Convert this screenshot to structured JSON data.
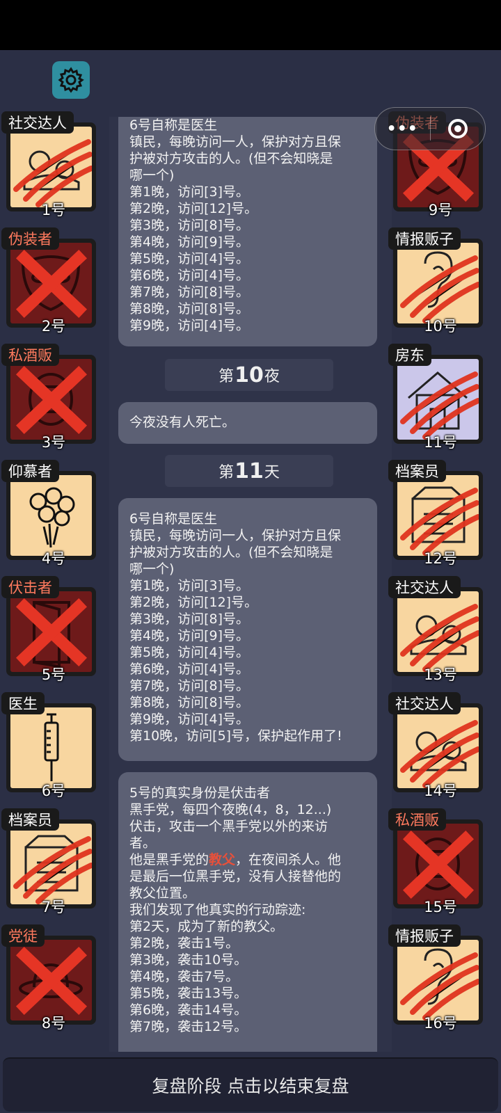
{
  "log": {
    "card1_lines": [
      "6号自称是医生",
      "镇民，每晚访问一人，保护对方且保",
      "护被对方攻击的人。(但不会知晓是",
      "哪一个)",
      "第1晚，访问[3]号。",
      "第2晚，访问[12]号。",
      "第3晚，访问[8]号。",
      "第4晚，访问[9]号。",
      "第5晚，访问[4]号。",
      "第6晚，访问[4]号。",
      "第7晚，访问[8]号。",
      "第8晚，访问[8]号。",
      "第9晚，访问[4]号。"
    ],
    "night10": {
      "pre": "第",
      "num": "10",
      "post": "夜"
    },
    "card2_text": "今夜没有人死亡。",
    "day11": {
      "pre": "第",
      "num": "11",
      "post": "天"
    },
    "card3_lines": [
      "6号自称是医生",
      "镇民，每晚访问一人，保护对方且保",
      "护被对方攻击的人。(但不会知晓是",
      "哪一个)",
      "第1晚，访问[3]号。",
      "第2晚，访问[12]号。",
      "第3晚，访问[8]号。",
      "第4晚，访问[9]号。",
      "第5晚，访问[4]号。",
      "第6晚，访问[4]号。",
      "第7晚，访问[8]号。",
      "第8晚，访问[8]号。",
      "第9晚，访问[4]号。",
      "第10晚，访问[5]号，保护起作用了!"
    ],
    "card4": {
      "l1": "5号的真实身份是伏击者",
      "l2": "黑手党，每四个夜晚(4，8，12...)",
      "l3": "伏击，攻击一个黑手党以外的来访",
      "l4": "者。",
      "l5_pre": "他是黑手党的",
      "l5_red": "教父",
      "l5_post": "，在夜间杀人。他",
      "l6": "是最后一位黑手党，没有人接替他的",
      "l7": "教父位置。",
      "l8": "我们发现了他真实的行动踪迹:",
      "l9": "第2天，成为了新的教父。",
      "l10": "第2晚，袭击1号。",
      "l11": "第3晚，袭击10号。",
      "l12": "第4晚，袭击7号。",
      "l13": "第5晚，袭击13号。",
      "l14": "第6晚，袭击14号。",
      "l15": "第7晚，袭击12号。"
    }
  },
  "players_left": [
    {
      "role": "社交达人",
      "num": "1号",
      "state": "clawed",
      "tile": "alive",
      "icon": "gears-icon"
    },
    {
      "role": "伪装者",
      "num": "2号",
      "state": "crossed",
      "tile": "dead",
      "icon": "mask-icon",
      "red": true
    },
    {
      "role": "私酒贩",
      "num": "3号",
      "state": "crossed",
      "tile": "dead",
      "icon": "barrel-icon",
      "red": true
    },
    {
      "role": "仰慕者",
      "num": "4号",
      "state": "none",
      "tile": "alive",
      "icon": "roses-icon"
    },
    {
      "role": "伏击者",
      "num": "5号",
      "state": "crossed",
      "tile": "dead",
      "icon": "door-icon",
      "red": true
    },
    {
      "role": "医生",
      "num": "6号",
      "state": "none",
      "tile": "alive",
      "icon": "syringe-icon"
    },
    {
      "role": "档案员",
      "num": "7号",
      "state": "clawed",
      "tile": "alive",
      "icon": "archive-icon"
    },
    {
      "role": "党徒",
      "num": "8号",
      "state": "crossed",
      "tile": "dead",
      "icon": "hat-icon",
      "red": true
    }
  ],
  "players_right": [
    {
      "role": "伪装者",
      "num": "9号",
      "state": "crossed",
      "tile": "dead",
      "icon": "mask-icon",
      "red": true
    },
    {
      "role": "情报贩子",
      "num": "10号",
      "state": "clawed",
      "tile": "alive",
      "icon": "ear-icon"
    },
    {
      "role": "房东",
      "num": "11号",
      "state": "clawed",
      "tile": "blue",
      "icon": "house-icon"
    },
    {
      "role": "档案员",
      "num": "12号",
      "state": "clawed",
      "tile": "alive",
      "icon": "archive-icon"
    },
    {
      "role": "社交达人",
      "num": "13号",
      "state": "clawed",
      "tile": "alive",
      "icon": "gears-icon"
    },
    {
      "role": "社交达人",
      "num": "14号",
      "state": "clawed",
      "tile": "alive",
      "icon": "gears-icon"
    },
    {
      "role": "私酒贩",
      "num": "15号",
      "state": "crossed",
      "tile": "dead",
      "icon": "barrel-icon",
      "red": true
    },
    {
      "role": "情报贩子",
      "num": "16号",
      "state": "clawed",
      "tile": "alive",
      "icon": "ear-icon"
    }
  ],
  "capsule": {
    "more": "•••"
  },
  "bottom_button": "复盘阶段 点击以结束复盘",
  "colors": {
    "accent_red": "#e8503a",
    "tile_alive": "#f8d6a0",
    "tile_dead": "#6e1a1a",
    "gear": "#2f8fa0"
  }
}
